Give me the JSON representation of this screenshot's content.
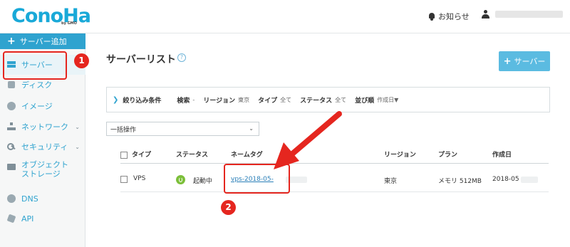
{
  "header": {
    "logo_text": "ConoHa",
    "logo_sub": "by GMO",
    "notice_label": "お知らせ"
  },
  "sidebar": {
    "add_label": "サーバー追加",
    "items": [
      {
        "label": "サーバー",
        "icon": "server-icon"
      },
      {
        "label": "ディスク",
        "icon": "disk-icon"
      },
      {
        "label": "イメージ",
        "icon": "globe-icon"
      },
      {
        "label": "ネットワーク",
        "icon": "network-icon"
      },
      {
        "label": "セキュリティ",
        "icon": "key-icon"
      },
      {
        "label": "オブジェクト",
        "label2": "ストレージ",
        "icon": "folder-icon"
      },
      {
        "label": "DNS",
        "icon": "dns-icon"
      },
      {
        "label": "API",
        "icon": "api-icon"
      }
    ]
  },
  "main": {
    "title": "サーバーリスト",
    "help": "?",
    "server_button": "サーバー",
    "filter": {
      "label": "絞り込み条件",
      "search_label": "検索",
      "search_value": "-",
      "region_label": "リージョン",
      "region_value": "東京",
      "type_label": "タイプ",
      "type_value": "全て",
      "status_label": "ステータス",
      "status_value": "全て",
      "sort_label": "並び順",
      "sort_value": "作成日▼"
    },
    "bulk_select": "一括操作",
    "table": {
      "headers": [
        "タイプ",
        "ステータス",
        "ネームタグ",
        "リージョン",
        "プラン",
        "作成日"
      ],
      "rows": [
        {
          "type": "VPS",
          "status": "起動中",
          "name_tag": "vps-2018-05-",
          "region": "東京",
          "plan": "メモリ 512MB",
          "created": "2018-05"
        }
      ]
    }
  },
  "annotations": {
    "step1": "1",
    "step2": "2"
  },
  "colors": {
    "accent": "#2fa3cf",
    "annotation": "#e5261f",
    "status_running": "#7cbf3a"
  }
}
